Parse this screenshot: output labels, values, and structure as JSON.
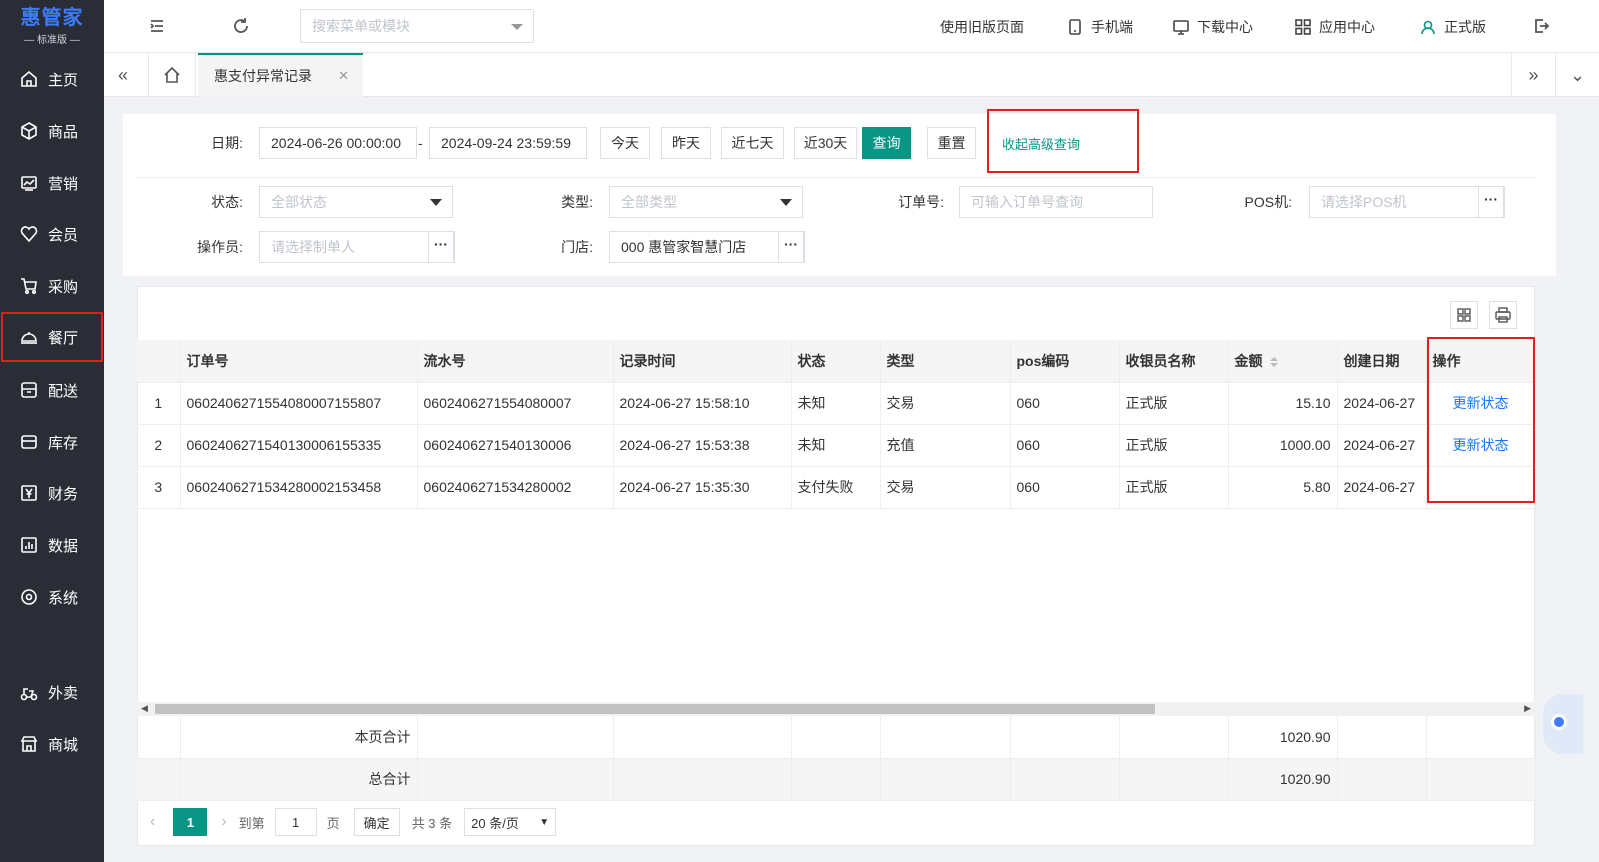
{
  "app": {
    "brand": "惠管家",
    "edition": "— 标准版 —"
  },
  "sidebar": {
    "items": [
      {
        "label": "主页",
        "icon": "home-icon"
      },
      {
        "label": "商品",
        "icon": "box-icon"
      },
      {
        "label": "营销",
        "icon": "chart-icon"
      },
      {
        "label": "会员",
        "icon": "heart-icon"
      },
      {
        "label": "采购",
        "icon": "cart-icon"
      },
      {
        "label": "餐厅",
        "icon": "cloche-icon"
      },
      {
        "label": "配送",
        "icon": "delivery-icon"
      },
      {
        "label": "库存",
        "icon": "inventory-icon"
      },
      {
        "label": "财务",
        "icon": "yen-icon"
      },
      {
        "label": "数据",
        "icon": "data-icon"
      },
      {
        "label": "系统",
        "icon": "settings-icon"
      },
      {
        "label": "外卖",
        "icon": "takeout-icon"
      },
      {
        "label": "商城",
        "icon": "store-icon"
      }
    ]
  },
  "topbar": {
    "search_placeholder": "搜索菜单或模块",
    "old_page": "使用旧版页面",
    "mobile": "手机端",
    "download": "下载中心",
    "apps": "应用中心",
    "user": "正式版"
  },
  "tabs": {
    "active": "惠支付异常记录"
  },
  "filters": {
    "date_label": "日期:",
    "date_start": "2024-06-26 00:00:00",
    "date_sep": "-",
    "date_end": "2024-09-24 23:59:59",
    "btn_today": "今天",
    "btn_yesterday": "昨天",
    "btn_7days": "近七天",
    "btn_30days": "近30天",
    "btn_query": "查询",
    "btn_reset": "重置",
    "advanced": "收起高级查询",
    "status_label": "状态:",
    "status_value": "全部状态",
    "type_label": "类型:",
    "type_value": "全部类型",
    "order_label": "订单号:",
    "order_placeholder": "可输入订单号查询",
    "pos_label": "POS机:",
    "pos_placeholder": "请选择POS机",
    "operator_label": "操作员:",
    "operator_placeholder": "请选择制单人",
    "store_label": "门店:",
    "store_value": "000  惠管家智慧门店",
    "dots": "···"
  },
  "table": {
    "columns": [
      "",
      "订单号",
      "流水号",
      "记录时间",
      "状态",
      "类型",
      "pos编码",
      "收银员名称",
      "金额",
      "创建日期",
      "操作"
    ],
    "rows": [
      {
        "idx": "1",
        "order": "06024062715540800071558O7",
        "serial": "0602406271554080007",
        "time": "2024-06-27 15:58:10",
        "status": "未知",
        "type": "交易",
        "pos": "060",
        "cashier": "正式版",
        "amount": "15.10",
        "date": "2024-06-27",
        "op": "更新状态"
      },
      {
        "idx": "2",
        "order": "06024062715401300061553 35",
        "serial": "0602406271540130006",
        "time": "2024-06-27 15:53:38",
        "status": "未知",
        "type": "充值",
        "pos": "060",
        "cashier": "正式版",
        "amount": "1000.00",
        "date": "2024-06-27",
        "op": "更新状态"
      },
      {
        "idx": "3",
        "order": "06024062715342800021534 58",
        "serial": "0602406271534280002",
        "time": "2024-06-27 15:35:30",
        "status": "支付失败",
        "type": "交易",
        "pos": "060",
        "cashier": "正式版",
        "amount": "5.80",
        "date": "2024-06-27",
        "op": ""
      }
    ],
    "page_total_label": "本页合计",
    "page_total": "1020.90",
    "grand_total_label": "总合计",
    "grand_total": "1020.90"
  },
  "pager": {
    "current": "1",
    "goto_label": "到第",
    "goto_value": "1",
    "page_unit": "页",
    "confirm": "确定",
    "total": "共 3 条",
    "page_size": "20 条/页"
  },
  "colors": {
    "accent": "#0a9484",
    "sidebar_bg": "#2a2d35",
    "link": "#1677ff",
    "highlight": "#e02020"
  }
}
